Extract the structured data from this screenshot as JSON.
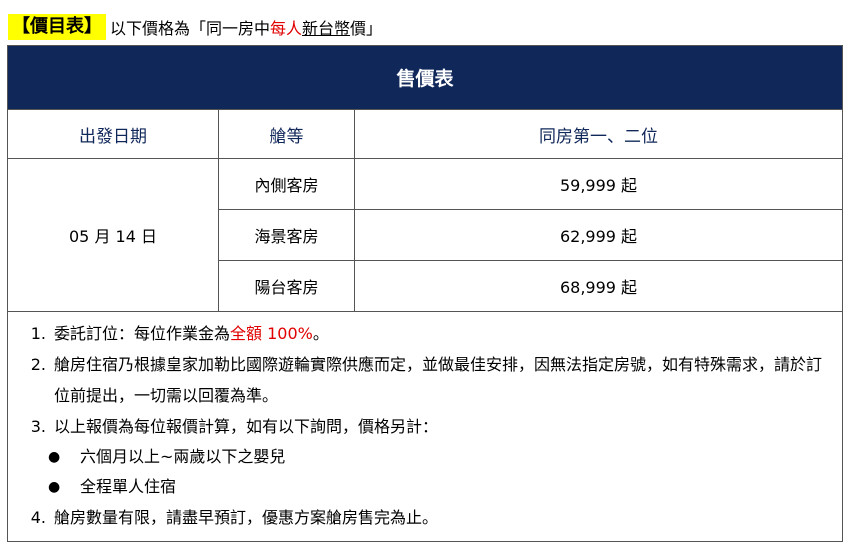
{
  "header": {
    "badge": "【價目表】",
    "intro_prefix": "以下價格為「同一房中",
    "intro_red": "每人",
    "intro_ul": "新台幣",
    "intro_suffix": "價」"
  },
  "table": {
    "title": "售價表",
    "columns": [
      "出發日期",
      "艙等",
      "同房第一、二位"
    ],
    "date": "05 月 14 日",
    "rows": [
      {
        "cabin": "內側客房",
        "price": "59,999 起"
      },
      {
        "cabin": "海景客房",
        "price": "62,999 起"
      },
      {
        "cabin": "陽台客房",
        "price": "68,999 起"
      }
    ]
  },
  "notes": {
    "n1": {
      "num": "1.",
      "pre": "委託訂位：每位作業金為",
      "red": "全額 100%",
      "post": "。"
    },
    "n2": {
      "num": "2.",
      "text": "艙房住宿乃根據皇家加勒比國際遊輪實際供應而定，並做最佳安排，因無法指定房號，如有特殊需求，請於訂位前提出，一切需以回覆為準。"
    },
    "n3": {
      "num": "3.",
      "text": "以上報價為每位報價計算，如有以下詢問，價格另計："
    },
    "bullets": [
      {
        "symbol": "●",
        "text": "六個月以上~兩歲以下之嬰兒"
      },
      {
        "symbol": "●",
        "text": "全程單人住宿"
      }
    ],
    "n4": {
      "num": "4.",
      "text": "艙房數量有限，請盡早預訂，優惠方案艙房售完為止。"
    }
  },
  "colors": {
    "navy": "#10275a",
    "highlight": "#ffff00",
    "accent_red": "#e00000"
  }
}
